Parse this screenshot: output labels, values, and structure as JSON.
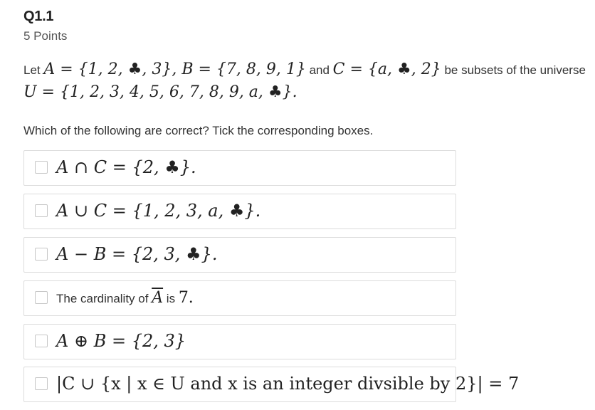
{
  "question": {
    "title": "Q1.1",
    "points": "5 Points",
    "stem_let": "Let ",
    "set_a": "A = {1, 2, ♣, 3}, B = {7, 8, 9, 1}",
    "stem_and": " and ",
    "set_c": "C = {a, ♣, 2}",
    "stem_subsets": " be subsets of the universe",
    "universe": "U = {1, 2, 3, 4, 5, 6, 7, 8, 9, a, ♣}."
  },
  "instruction": "Which of the following are correct? Tick the corresponding boxes.",
  "options": [
    {
      "label": "A ∩ C = {2, ♣}."
    },
    {
      "label": "A ∪ C = {1, 2, 3, a, ♣}."
    },
    {
      "label": "A − B = {2, 3, ♣}."
    },
    {
      "prefix": "The cardinality of ",
      "math": "A",
      "middle": " is ",
      "value": "7."
    },
    {
      "label": "A ⊕ B = {2, 3}"
    },
    {
      "label": "|C ∪ {x | x ∈ U and x is an integer divsible by 2}| = 7"
    }
  ]
}
